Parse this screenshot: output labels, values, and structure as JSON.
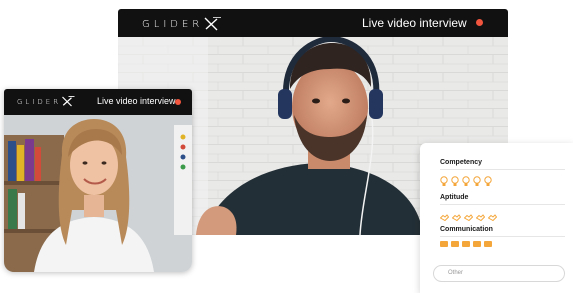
{
  "main_window": {
    "brand": "GLIDER",
    "title": "Live video interview"
  },
  "guest_window": {
    "brand": "GLIDER",
    "title": "Live video interview"
  },
  "evaluation": {
    "criteria": [
      {
        "label": "Competency",
        "icon": "lightbulb-icon",
        "count": 5
      },
      {
        "label": "Aptitude",
        "icon": "handshake-icon",
        "count": 5
      },
      {
        "label": "Communication",
        "icon": "signal-bar-icon",
        "count": 5
      }
    ],
    "comment_placeholder": "Other"
  },
  "colors": {
    "title_bar": "#111111",
    "record_dot": "#f2553e",
    "rating_accent": "#f4a63a"
  }
}
